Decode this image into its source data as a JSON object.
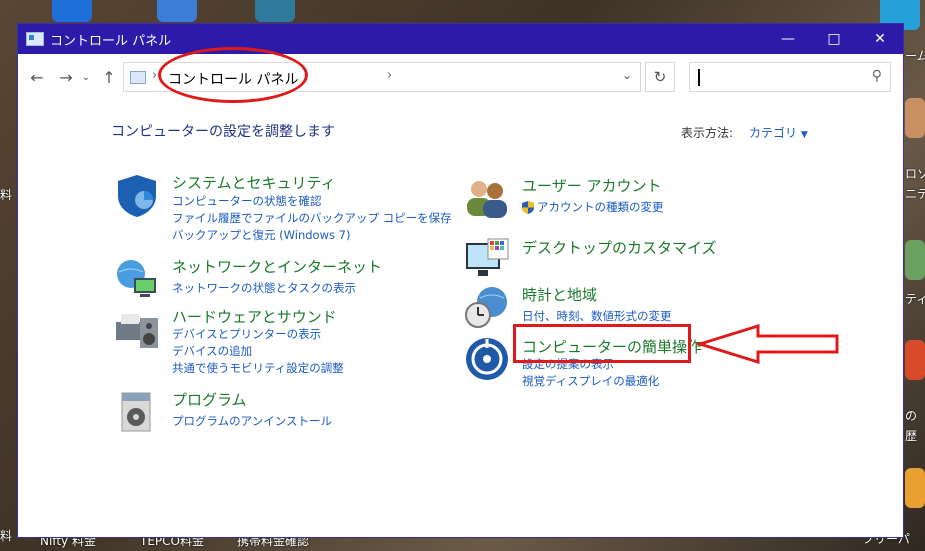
{
  "window": {
    "title": "コントロール パネル"
  },
  "address": {
    "crumb": "コントロール パネル",
    "search_placeholder": ""
  },
  "header": {
    "heading": "コンピューターの設定を調整します",
    "view_by_label": "表示方法:",
    "view_by_value": "カテゴリ"
  },
  "categories_left": [
    {
      "title": "システムとセキュリティ",
      "links": [
        "コンピューターの状態を確認",
        "ファイル履歴でファイルのバックアップ コピーを保存",
        "バックアップと復元 (Windows 7)"
      ]
    },
    {
      "title": "ネットワークとインターネット",
      "links": [
        "ネットワークの状態とタスクの表示"
      ]
    },
    {
      "title": "ハードウェアとサウンド",
      "links": [
        "デバイスとプリンターの表示",
        "デバイスの追加",
        "共通で使うモビリティ設定の調整"
      ]
    },
    {
      "title": "プログラム",
      "links": [
        "プログラムのアンインストール"
      ]
    }
  ],
  "categories_right": [
    {
      "title": "ユーザー アカウント",
      "links": [
        "アカウントの種類の変更"
      ]
    },
    {
      "title": "デスクトップのカスタマイズ",
      "links": []
    },
    {
      "title": "時計と地域",
      "links": [
        "日付、時刻、数値形式の変更"
      ]
    },
    {
      "title": "コンピューターの簡単操作",
      "links": [
        "設定の提案の表示",
        "視覚ディスプレイの最適化"
      ]
    }
  ],
  "desktop": {
    "labels": [
      "ーム",
      "ロソフ",
      "ニテ",
      "ティ",
      "の",
      "歴",
      "料",
      "Nifty 料金",
      "TEPCO料金",
      "携帯料金確認",
      "フリーパ"
    ]
  },
  "colors": {
    "accent": "#1a5bc5",
    "category_title": "#1a7a2a",
    "titlebar": "#2e1aa8",
    "annotation": "#e01a1a"
  }
}
